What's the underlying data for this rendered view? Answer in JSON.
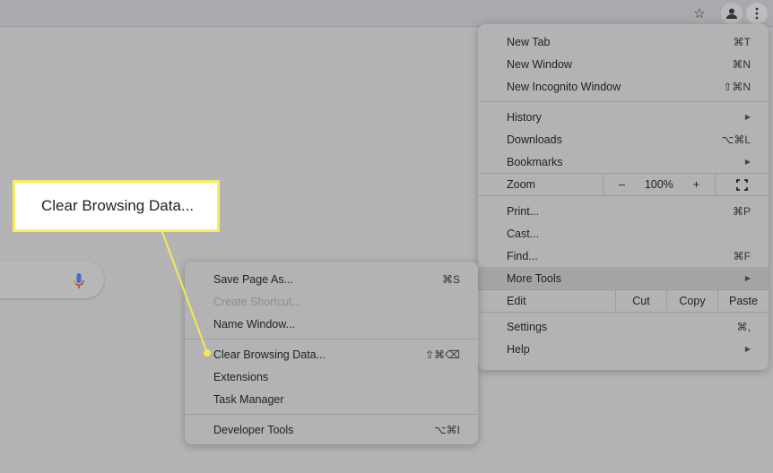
{
  "toolbar": {
    "icons": [
      "star-icon",
      "profile-icon",
      "menu-icon"
    ]
  },
  "callout": {
    "text": "Clear Browsing Data..."
  },
  "main_menu": {
    "group1": [
      {
        "label": "New Tab",
        "shortcut": "⌘T"
      },
      {
        "label": "New Window",
        "shortcut": "⌘N"
      },
      {
        "label": "New Incognito Window",
        "shortcut": "⇧⌘N"
      }
    ],
    "group2": [
      {
        "label": "History",
        "submenu": true
      },
      {
        "label": "Downloads",
        "shortcut": "⌥⌘L"
      },
      {
        "label": "Bookmarks",
        "submenu": true
      }
    ],
    "zoom": {
      "label": "Zoom",
      "minus": "–",
      "value": "100%",
      "plus": "+"
    },
    "group3": [
      {
        "label": "Print...",
        "shortcut": "⌘P"
      },
      {
        "label": "Cast...",
        "shortcut": ""
      },
      {
        "label": "Find...",
        "shortcut": "⌘F"
      },
      {
        "label": "More Tools",
        "submenu": true,
        "highlighted": true
      }
    ],
    "edit": {
      "label": "Edit",
      "cut": "Cut",
      "copy": "Copy",
      "paste": "Paste"
    },
    "group4": [
      {
        "label": "Settings",
        "shortcut": "⌘,"
      },
      {
        "label": "Help",
        "submenu": true
      }
    ]
  },
  "sub_menu": {
    "group1": [
      {
        "label": "Save Page As...",
        "shortcut": "⌘S"
      },
      {
        "label": "Create Shortcut...",
        "disabled": true
      },
      {
        "label": "Name Window..."
      }
    ],
    "group2": [
      {
        "label": "Clear Browsing Data...",
        "shortcut": "⇧⌘⌫"
      },
      {
        "label": "Extensions"
      },
      {
        "label": "Task Manager"
      }
    ],
    "group3": [
      {
        "label": "Developer Tools",
        "shortcut": "⌥⌘I"
      }
    ]
  },
  "colors": {
    "callout_border": "#f6ee5c",
    "highlight": "#a5a5a7"
  }
}
